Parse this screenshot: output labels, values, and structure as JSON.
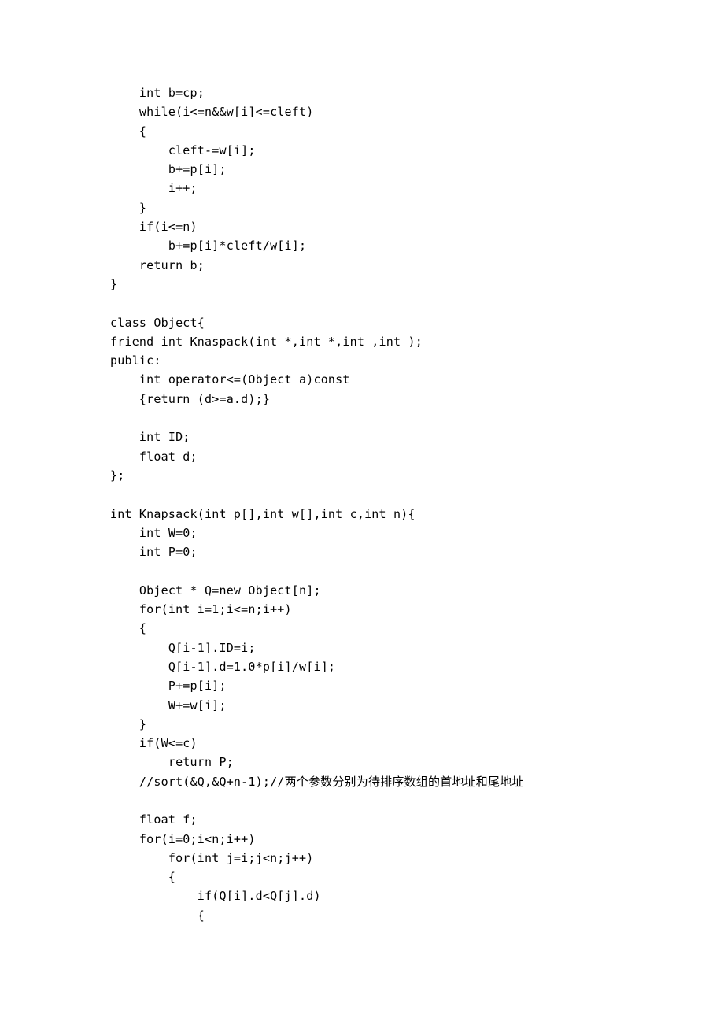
{
  "code": {
    "lines": [
      "    int b=cp;",
      "    while(i<=n&&w[i]<=cleft)",
      "    {",
      "        cleft-=w[i];",
      "        b+=p[i];",
      "        i++;",
      "    }",
      "    if(i<=n)",
      "        b+=p[i]*cleft/w[i];",
      "    return b;",
      "}",
      "",
      "class Object{",
      "friend int Knaspack(int *,int *,int ,int );",
      "public:",
      "    int operator<=(Object a)const",
      "    {return (d>=a.d);}",
      "",
      "    int ID;",
      "    float d;",
      "};",
      "",
      "int Knapsack(int p[],int w[],int c,int n){",
      "    int W=0;",
      "    int P=0;",
      "",
      "    Object * Q=new Object[n];",
      "    for(int i=1;i<=n;i++)",
      "    {",
      "        Q[i-1].ID=i;",
      "        Q[i-1].d=1.0*p[i]/w[i];",
      "        P+=p[i];",
      "        W+=w[i];",
      "    }",
      "    if(W<=c)",
      "        return P;",
      "    //sort(&Q,&Q+n-1);//两个参数分别为待排序数组的首地址和尾地址",
      "",
      "    float f;",
      "    for(i=0;i<n;i++)",
      "        for(int j=i;j<n;j++)",
      "        {",
      "            if(Q[i].d<Q[j].d)",
      "            {"
    ]
  }
}
